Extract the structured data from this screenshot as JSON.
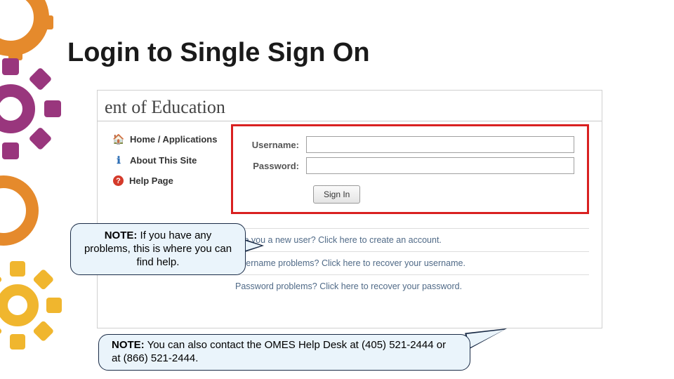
{
  "title": "Login to Single Sign On",
  "brand_text": "ent of Education",
  "nav": {
    "items": [
      {
        "label": "Home / Applications",
        "icon": "home-icon",
        "glyph": "🏠",
        "color": "#e58a2c"
      },
      {
        "label": "About This Site",
        "icon": "info-icon",
        "glyph": "ℹ",
        "color": "#2e6fb5"
      },
      {
        "label": "Help Page",
        "icon": "help-icon",
        "glyph": "?",
        "color": "#d43a2a"
      }
    ]
  },
  "form": {
    "username_label": "Username:",
    "password_label": "Password:",
    "signin_label": "Sign In"
  },
  "links": {
    "new_user": "Are you a new user? Click here to create an account.",
    "username": "Username problems? Click here to recover your username.",
    "password": "Password problems? Click here to recover your password."
  },
  "callouts": {
    "help_note_label": "NOTE:",
    "help_note_text": "  If you have any problems, this is where you can find help.",
    "omes_note_label": "NOTE:",
    "omes_note_text": "  You can also contact the OMES Help Desk at (405) 521-2444 or at (866) 521-2444."
  }
}
